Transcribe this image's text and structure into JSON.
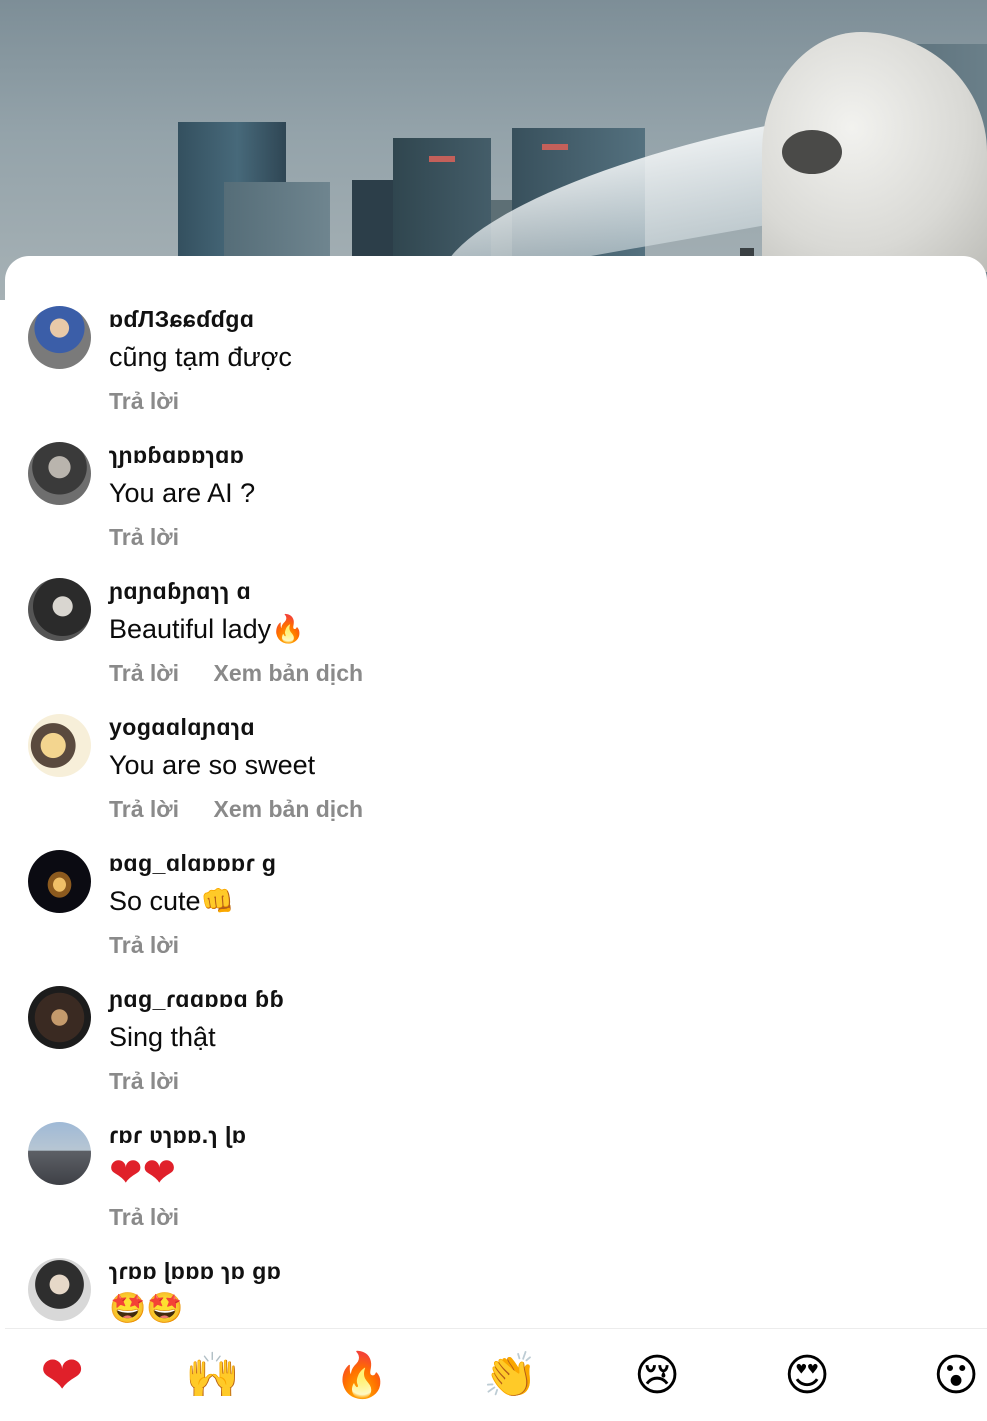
{
  "comments": [
    {
      "username": "ɒɗЛЗɕɕɗɗɡɑ",
      "text": "cũng tạm được",
      "actions": [
        "Trả lời"
      ]
    },
    {
      "username": "ɿɲɒɓɑɒɒɿɑɒ",
      "text": "You are AI ?",
      "actions": [
        "Trả lời"
      ]
    },
    {
      "username": "ɲɑɲɑɓɲɑɿɿ ɑ",
      "text": "Beautiful lady🔥",
      "actions": [
        "Trả lời",
        "Xem bản dịch"
      ]
    },
    {
      "username": "yogɑɑlɑɲɑɿɑ",
      "text": "You are so sweet",
      "actions": [
        "Trả lời",
        "Xem bản dịch"
      ]
    },
    {
      "username": "ɒɑg_ɑlɑɒɒɒɾ ɡ",
      "text": "So cute👊",
      "actions": [
        "Trả lời"
      ]
    },
    {
      "username": "ɲɑɡ_ɾɑɑɒɒɑ ɓɓ",
      "text": "Sing thật",
      "actions": [
        "Trả lời"
      ]
    },
    {
      "username": "ɾɒɾ ʋɿɒɒ.ɿ ɭɒ",
      "text": "❤❤",
      "actions": [
        "Trả lời"
      ]
    },
    {
      "username": "ɿɾɒɒ ɭɒɒɒ ɿɒ ɡɒ",
      "text": "🤩🤩",
      "actions": []
    }
  ],
  "reactions": [
    {
      "icon": "heart-icon",
      "glyph": "❤"
    },
    {
      "icon": "raising-hands-icon",
      "glyph": "🙌"
    },
    {
      "icon": "fire-icon",
      "glyph": "🔥"
    },
    {
      "icon": "clapping-hands-icon",
      "glyph": "👏"
    },
    {
      "icon": "crying-face-icon",
      "glyph": "😢"
    },
    {
      "icon": "heart-eyes-icon",
      "glyph": "😍"
    },
    {
      "icon": "surprised-face-icon",
      "glyph": "😮"
    }
  ],
  "colors": {
    "sheet_bg": "#ffffff",
    "text_primary": "#0b0b0b",
    "text_secondary": "#8a8a8a",
    "heart_red": "#e0202a"
  }
}
